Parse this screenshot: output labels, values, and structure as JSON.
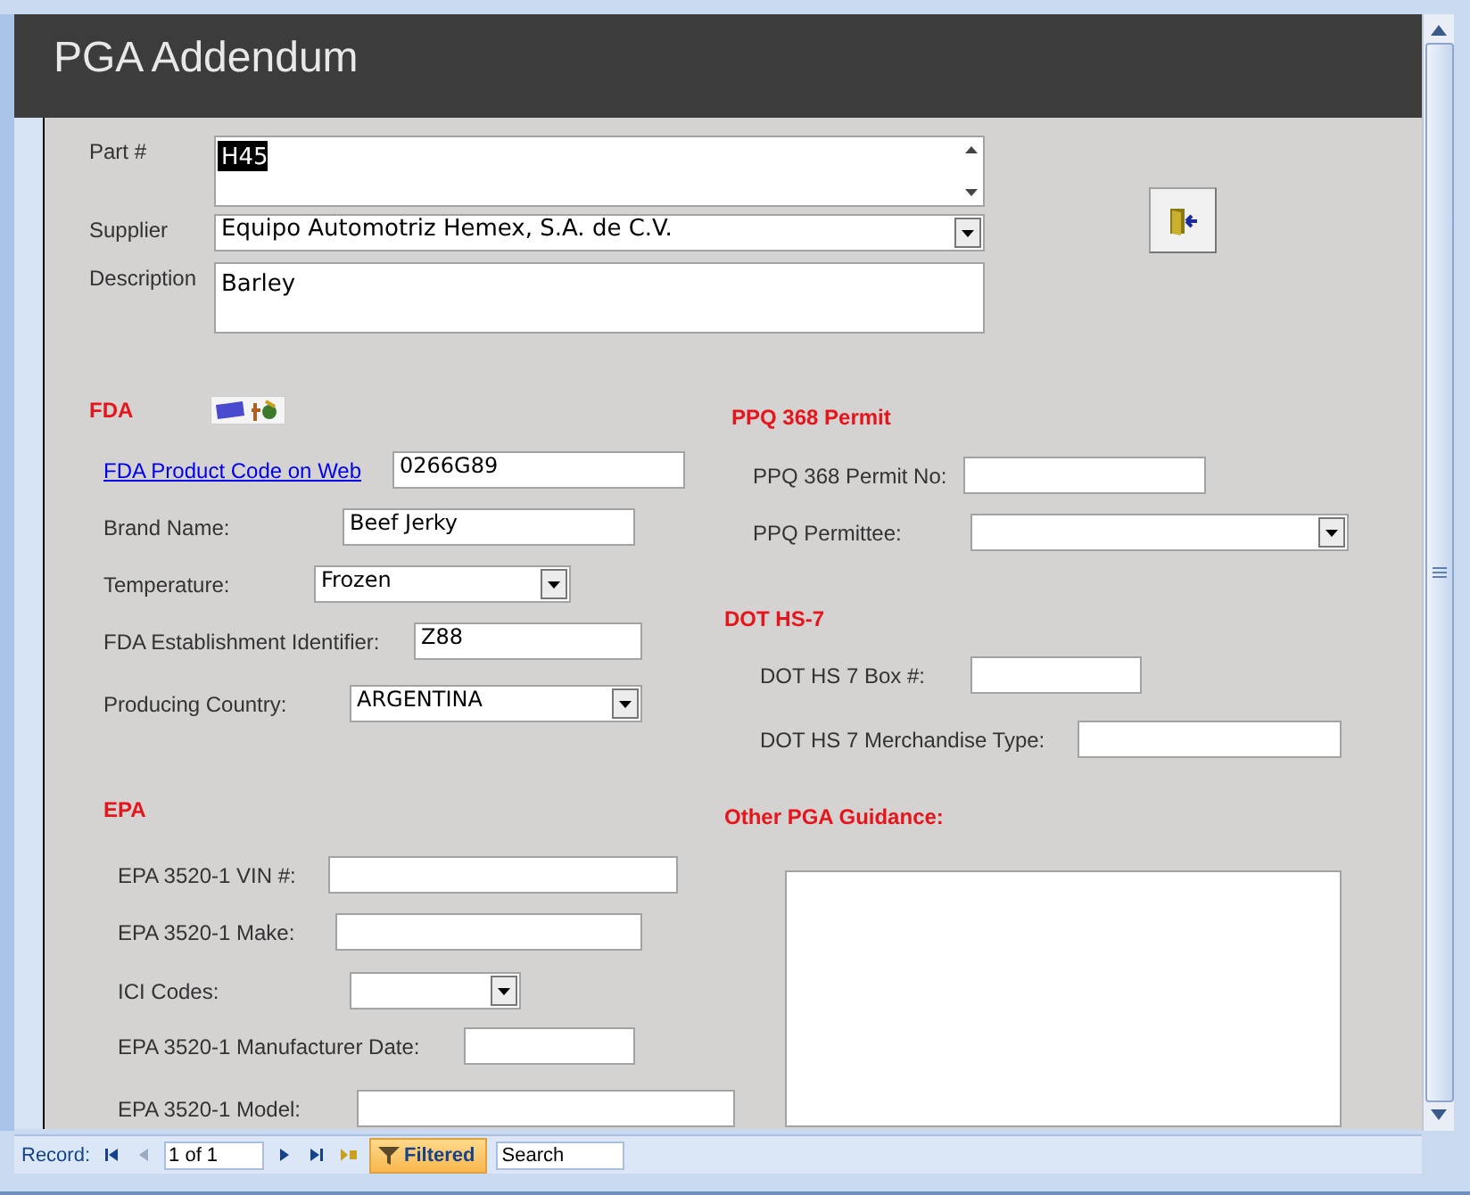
{
  "title": "PGA Addendum",
  "top_fields": [
    {
      "label": "Part #",
      "kind": "memo",
      "value": "H45",
      "selected": true
    },
    {
      "label": "Supplier",
      "kind": "combo",
      "value": "Equipo Automotriz Hemex, S.A. de C.V."
    },
    {
      "label": "Description",
      "kind": "memo",
      "value": "Barley",
      "selected": false
    }
  ],
  "left_sections": [
    {
      "heading": "FDA",
      "has_logo": true,
      "fields": [
        {
          "label": "FDA Product Code on Web",
          "link": true,
          "kind": "text",
          "value": "0266G89"
        },
        {
          "label": "Brand Name:",
          "link": false,
          "kind": "text",
          "value": "Beef Jerky"
        },
        {
          "label": "Temperature:",
          "link": false,
          "kind": "combo",
          "value": "Frozen"
        },
        {
          "label": "FDA Establishment Identifier:",
          "link": false,
          "kind": "text",
          "value": "Z88"
        },
        {
          "label": "Producing Country:",
          "link": false,
          "kind": "combo",
          "value": "ARGENTINA"
        }
      ]
    },
    {
      "heading": "EPA",
      "fields": [
        {
          "label": "EPA 3520-1 VIN #:",
          "link": false,
          "kind": "text"
        },
        {
          "label": "EPA 3520-1 Make:",
          "link": false,
          "kind": "text"
        },
        {
          "label": "ICI Codes:",
          "link": false,
          "kind": "combo"
        },
        {
          "label": "EPA 3520-1 Manufacturer Date:",
          "link": false,
          "kind": "text"
        },
        {
          "label": "EPA 3520-1 Model:",
          "link": false,
          "kind": "text"
        }
      ]
    }
  ],
  "right_sections": [
    {
      "heading": "PPQ 368 Permit",
      "fields": [
        {
          "label": "PPQ 368 Permit No:",
          "link": false,
          "kind": "text"
        },
        {
          "label": "PPQ Permittee:",
          "link": false,
          "kind": "combo"
        }
      ]
    },
    {
      "heading": "DOT HS-7",
      "fields": [
        {
          "label": "DOT HS 7 Box #:",
          "link": false,
          "kind": "text"
        },
        {
          "label": "DOT HS 7 Merchandise Type:",
          "link": false,
          "kind": "text"
        }
      ]
    },
    {
      "heading": "Other PGA Guidance:",
      "fields": [
        {
          "kind": "memo"
        }
      ]
    }
  ],
  "nav": {
    "label": "Record:",
    "position": "1 of 1",
    "filter": {
      "label": "Filtered",
      "on": true
    },
    "search": {
      "placeholder": "Search"
    }
  }
}
